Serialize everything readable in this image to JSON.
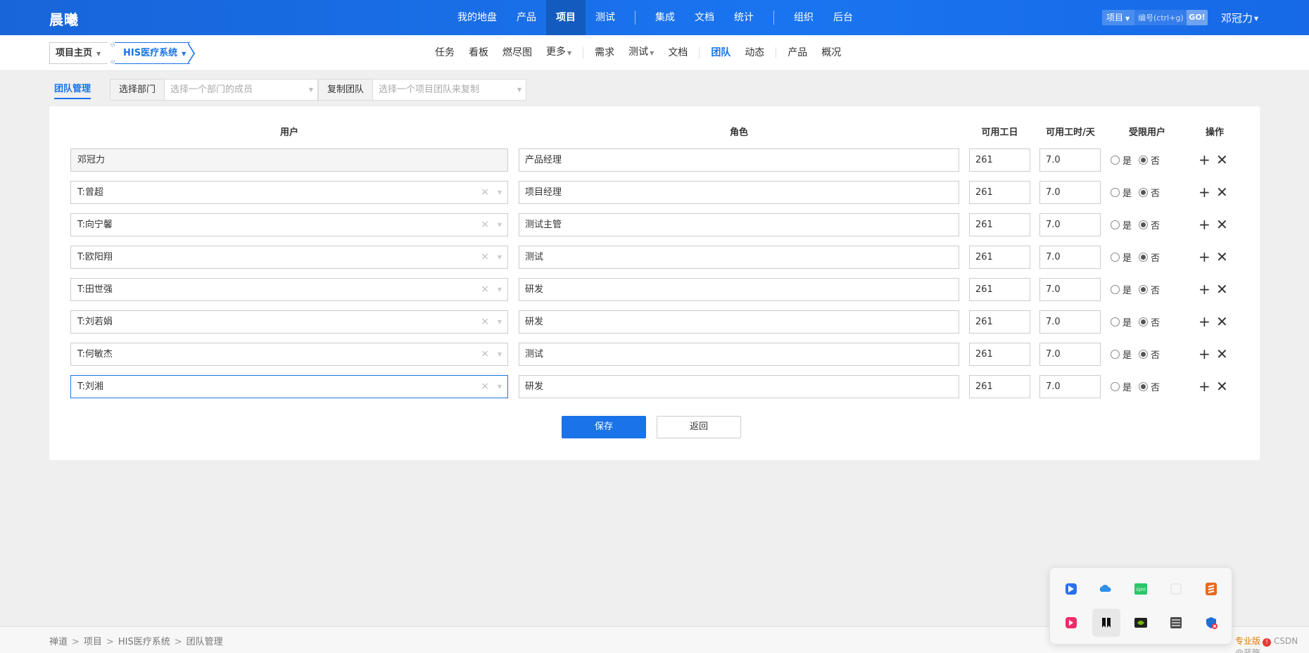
{
  "header": {
    "logo": "晨曦",
    "nav": [
      "我的地盘",
      "产品",
      "项目",
      "测试",
      "集成",
      "文档",
      "统计",
      "组织",
      "后台"
    ],
    "nav_active": "项目",
    "search": {
      "type": "项目",
      "placeholder": "编号(ctrl+g)",
      "go": "GO!"
    },
    "user": "邓冠力"
  },
  "subheader": {
    "home": "项目主页",
    "project": "HIS医疗系统",
    "nav": [
      "任务",
      "看板",
      "燃尽图",
      "更多",
      "需求",
      "测试",
      "文档",
      "团队",
      "动态",
      "产品",
      "概况"
    ],
    "nav_active": "团队"
  },
  "toolbar": {
    "tab": "团队管理",
    "dept_label": "选择部门",
    "dept_placeholder": "选择一个部门的成员",
    "copy_label": "复制团队",
    "copy_placeholder": "选择一个项目团队来复制"
  },
  "table": {
    "headers": {
      "user": "用户",
      "role": "角色",
      "days": "可用工日",
      "hours": "可用工时/天",
      "limited": "受限用户",
      "actions": "操作"
    },
    "radio_yes": "是",
    "radio_no": "否",
    "rows": [
      {
        "user": "邓冠力",
        "role": "产品经理",
        "days": "261",
        "hours": "7.0",
        "limited": "否",
        "locked": true
      },
      {
        "user": "T:曾超",
        "role": "项目经理",
        "days": "261",
        "hours": "7.0",
        "limited": "否"
      },
      {
        "user": "T:向宁馨",
        "role": "测试主管",
        "days": "261",
        "hours": "7.0",
        "limited": "否"
      },
      {
        "user": "T:欧阳翔",
        "role": "测试",
        "days": "261",
        "hours": "7.0",
        "limited": "否"
      },
      {
        "user": "T:田世强",
        "role": "研发",
        "days": "261",
        "hours": "7.0",
        "limited": "否"
      },
      {
        "user": "T:刘若娟",
        "role": "研发",
        "days": "261",
        "hours": "7.0",
        "limited": "否"
      },
      {
        "user": "T:何敏杰",
        "role": "测试",
        "days": "261",
        "hours": "7.0",
        "limited": "否"
      },
      {
        "user": "T:刘湘",
        "role": "研发",
        "days": "261",
        "hours": "7.0",
        "limited": "否",
        "focused": true
      }
    ]
  },
  "buttons": {
    "save": "保存",
    "back": "返回"
  },
  "footer": {
    "crumbs": [
      "禅道",
      "项目",
      "HIS医疗系统",
      "团队管理"
    ],
    "edition": "专业版",
    "badge": "!",
    "watermark": "CSDN @蓝殇"
  },
  "tray_icons": [
    "feishu-icon",
    "onedrive-icon",
    "iqiyi-icon",
    "blank-icon",
    "sublime-icon",
    "bilibili-icon",
    "notion-icon",
    "nvidia-icon",
    "archive-icon",
    "defender-icon"
  ],
  "colors": {
    "accent": "#1a73e8",
    "header_bg": "#1865d9",
    "page_bg": "#efefef"
  }
}
